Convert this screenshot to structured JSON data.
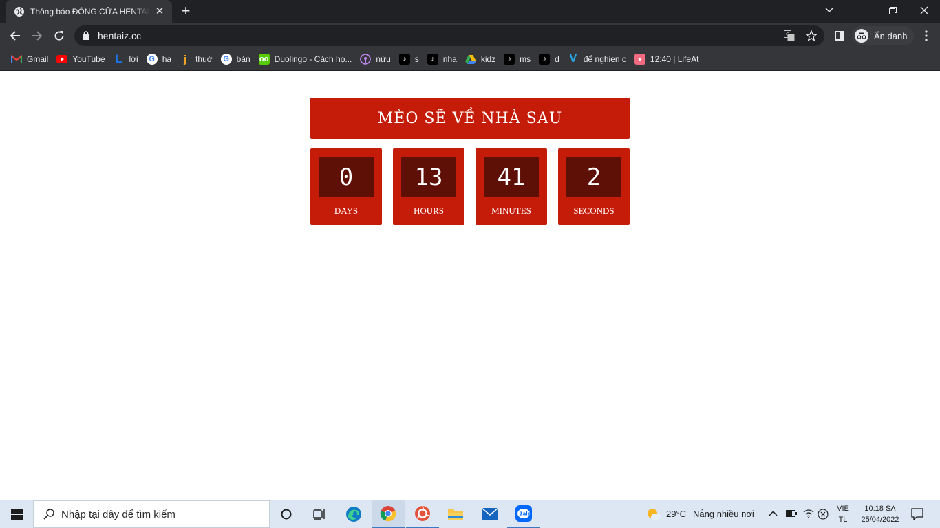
{
  "browser": {
    "tab_title": "Thông báo ĐÓNG CỬA HENTAIZ",
    "url": "hentaiz.cc",
    "profile_label": "Ẩn danh"
  },
  "bookmarks": [
    {
      "label": "Gmail",
      "icon": "gmail-icon"
    },
    {
      "label": "YouTube",
      "icon": "youtube-icon"
    },
    {
      "label": "lời",
      "icon": "l-icon"
    },
    {
      "label": "hạ",
      "icon": "google-icon"
    },
    {
      "label": "thuờ",
      "icon": "j-icon"
    },
    {
      "label": "bản",
      "icon": "google-icon"
    },
    {
      "label": "Duolingo - Cách họ...",
      "icon": "duolingo-icon"
    },
    {
      "label": "nứu",
      "icon": "podcast-icon"
    },
    {
      "label": "s",
      "icon": "tiktok-icon"
    },
    {
      "label": "nha",
      "icon": "tiktok-icon"
    },
    {
      "label": "kidz",
      "icon": "drive-icon"
    },
    {
      "label": "ms",
      "icon": "tiktok-icon"
    },
    {
      "label": "d",
      "icon": "tiktok-icon"
    },
    {
      "label": "để nghien c",
      "icon": "v-icon"
    },
    {
      "label": "12:40 | LifeAt",
      "icon": "lifeat-icon"
    }
  ],
  "page": {
    "banner": "MÈO SẼ VỀ NHÀ SAU",
    "countdown": [
      {
        "value": "0",
        "label": "DAYS"
      },
      {
        "value": "13",
        "label": "HOURS"
      },
      {
        "value": "41",
        "label": "MINUTES"
      },
      {
        "value": "2",
        "label": "SECONDS"
      }
    ]
  },
  "taskbar": {
    "search_placeholder": "Nhập tại đây để tìm kiếm",
    "weather_temp": "29°C",
    "weather_text": "Nắng nhiều nơi",
    "lang_top": "VIE",
    "lang_bottom": "TL",
    "time": "10:18 SA",
    "date": "25/04/2022"
  },
  "colors": {
    "accent_red": "#c51c09",
    "dark_red": "#5e0f06",
    "chrome_dark": "#202124",
    "chrome_toolbar": "#35363a"
  }
}
